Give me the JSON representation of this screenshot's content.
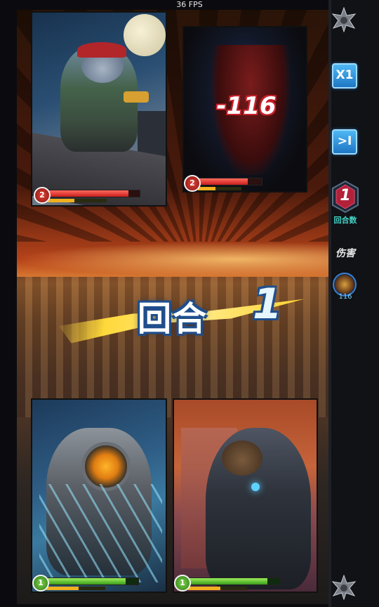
{
  "fps_counter": "36 FPS",
  "controls": {
    "speed_button_label": "X1",
    "skip_button_label": ">I"
  },
  "round": {
    "value": "1",
    "label": "回合数",
    "banner_word": "回合",
    "banner_number": "1"
  },
  "damage": {
    "label": "伤害",
    "value": "116"
  },
  "floating_damage": "-116",
  "cards": [
    {
      "id": "enemy-1",
      "team": "enemy",
      "level": "2",
      "hp_fraction": 0.88,
      "energy_fraction": 0.45,
      "icon": "cat-gunslinger"
    },
    {
      "id": "enemy-2",
      "team": "enemy",
      "level": "2",
      "hp_fraction": 0.78,
      "energy_fraction": 0.4,
      "icon": "shadow-demon"
    },
    {
      "id": "ally-1",
      "team": "ally",
      "level": "1",
      "hp_fraction": 0.86,
      "energy_fraction": 0.55,
      "icon": "diver-mech"
    },
    {
      "id": "ally-2",
      "team": "ally",
      "level": "1",
      "hp_fraction": 0.86,
      "energy_fraction": 0.55,
      "icon": "bear-mech"
    }
  ],
  "colors": {
    "enemy_hp": "#c81e1e",
    "ally_hp": "#3a9a1a",
    "energy": "#f0b020",
    "round_label": "#44d6c8",
    "button": "#1f76c4"
  }
}
